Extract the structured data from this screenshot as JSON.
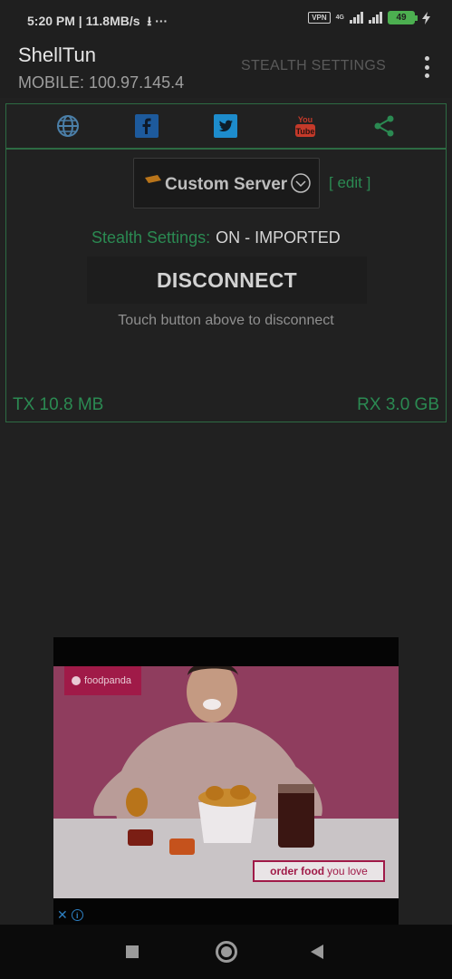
{
  "status_bar": {
    "time_speed": "5:20 PM | 11.8MB/s",
    "extra": "⭳ ···",
    "vpn": "VPN",
    "network": "4G",
    "battery": "49"
  },
  "app_bar": {
    "title": "ShellTun",
    "subtitle": "MOBILE: 100.97.145.4",
    "stealth_settings_button": "STEALTH SETTINGS"
  },
  "social_icons": [
    "globe-icon",
    "facebook-icon",
    "twitter-icon",
    "youtube-icon",
    "share-icon"
  ],
  "colors": {
    "accent_green": "#2b8a52",
    "border_green": "#2d6b43",
    "background": "#212121",
    "facebook": "#1d5a9c",
    "twitter": "#1d8ccc",
    "youtube": "#c43a2a"
  },
  "server": {
    "selected": "Custom Server",
    "edit": "[ edit ]"
  },
  "stealth": {
    "label": "Stealth Settings:",
    "value": "ON - IMPORTED"
  },
  "connection": {
    "button": "DISCONNECT",
    "hint": "Touch button above to disconnect"
  },
  "traffic": {
    "tx": "TX 10.8 MB",
    "rx": "RX 3.0 GB"
  },
  "ad": {
    "brand": "foodpanda",
    "tagline_strong": "order food",
    "tagline_rest": "you love",
    "close": "✕",
    "info": "i"
  }
}
